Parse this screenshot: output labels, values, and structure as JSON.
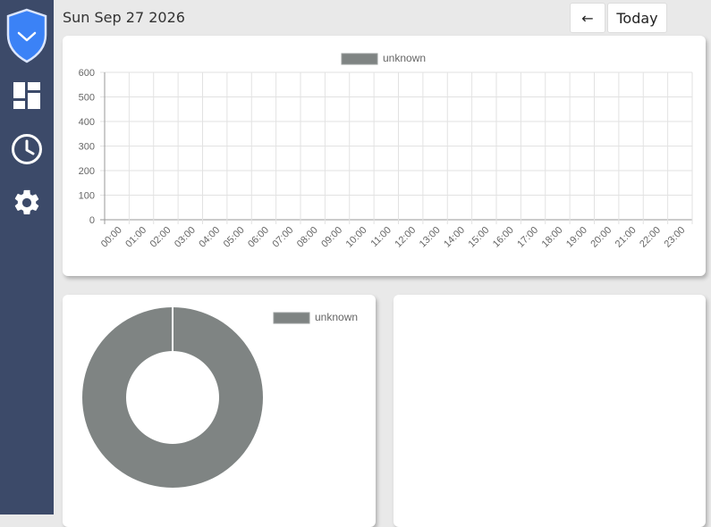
{
  "header": {
    "date": "Sun Sep 27 2026",
    "prev_label": "←",
    "today_label": "Today"
  },
  "sidebar": {
    "items": [
      {
        "name": "logo",
        "icon": "shield-check-icon"
      },
      {
        "name": "dashboard",
        "icon": "dashboard-icon"
      },
      {
        "name": "history",
        "icon": "clock-icon"
      },
      {
        "name": "settings",
        "icon": "gear-icon"
      }
    ]
  },
  "colors": {
    "sidebar": "#3c4a69",
    "shield": "#3b82f6",
    "series": "#7f8483"
  },
  "chart_data": [
    {
      "type": "bar",
      "legend": [
        "unknown"
      ],
      "categories": [
        "00:00",
        "01:00",
        "02:00",
        "03:00",
        "04:00",
        "05:00",
        "06:00",
        "07:00",
        "08:00",
        "09:00",
        "10:00",
        "11:00",
        "12:00",
        "13:00",
        "14:00",
        "15:00",
        "16:00",
        "17:00",
        "18:00",
        "19:00",
        "20:00",
        "21:00",
        "22:00",
        "23:00"
      ],
      "series": [
        {
          "name": "unknown",
          "values": [
            0,
            0,
            0,
            0,
            0,
            0,
            0,
            0,
            0,
            0,
            0,
            0,
            0,
            0,
            0,
            0,
            0,
            0,
            0,
            0,
            0,
            0,
            0,
            0
          ]
        }
      ],
      "yticks": [
        0,
        100,
        200,
        300,
        400,
        500,
        600
      ],
      "ylim": [
        0,
        600
      ],
      "grid": true,
      "legend_position": "top"
    },
    {
      "type": "pie",
      "donut": true,
      "legend_position": "top-right",
      "slices": [
        {
          "label": "unknown",
          "value": 100
        }
      ]
    }
  ]
}
